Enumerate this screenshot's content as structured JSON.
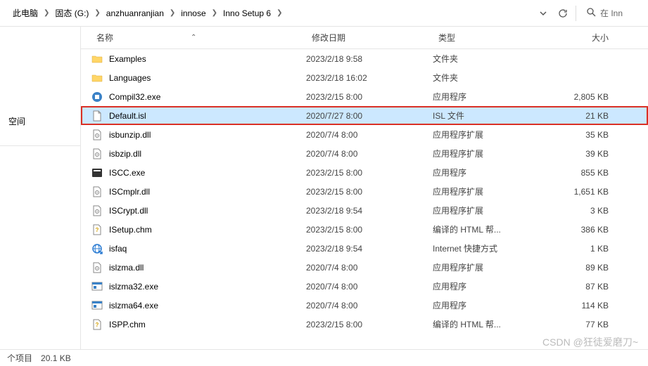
{
  "breadcrumb": [
    {
      "label": "此电脑"
    },
    {
      "label": "固态 (G:)"
    },
    {
      "label": "anzhuanranjian"
    },
    {
      "label": "innose"
    },
    {
      "label": "Inno Setup 6"
    }
  ],
  "search": {
    "placeholder": "在 Inn"
  },
  "nav": {
    "item1": "空间"
  },
  "columns": {
    "name": "名称",
    "date": "修改日期",
    "type": "类型",
    "size": "大小"
  },
  "files": [
    {
      "icon": "folder",
      "name": "Examples",
      "date": "2023/2/18 9:58",
      "type": "文件夹",
      "size": ""
    },
    {
      "icon": "folder",
      "name": "Languages",
      "date": "2023/2/18 16:02",
      "type": "文件夹",
      "size": ""
    },
    {
      "icon": "exe-blue",
      "name": "Compil32.exe",
      "date": "2023/2/15 8:00",
      "type": "应用程序",
      "size": "2,805 KB"
    },
    {
      "icon": "file",
      "name": "Default.isl",
      "date": "2020/7/27 8:00",
      "type": "ISL 文件",
      "size": "21 KB",
      "selected": true,
      "highlighted": true
    },
    {
      "icon": "dll",
      "name": "isbunzip.dll",
      "date": "2020/7/4 8:00",
      "type": "应用程序扩展",
      "size": "35 KB"
    },
    {
      "icon": "dll",
      "name": "isbzip.dll",
      "date": "2020/7/4 8:00",
      "type": "应用程序扩展",
      "size": "39 KB"
    },
    {
      "icon": "exe-dark",
      "name": "ISCC.exe",
      "date": "2023/2/15 8:00",
      "type": "应用程序",
      "size": "855 KB"
    },
    {
      "icon": "dll",
      "name": "ISCmplr.dll",
      "date": "2023/2/15 8:00",
      "type": "应用程序扩展",
      "size": "1,651 KB"
    },
    {
      "icon": "dll",
      "name": "ISCrypt.dll",
      "date": "2023/2/18 9:54",
      "type": "应用程序扩展",
      "size": "3 KB"
    },
    {
      "icon": "chm",
      "name": "ISetup.chm",
      "date": "2023/2/15 8:00",
      "type": "编译的 HTML 帮...",
      "size": "386 KB"
    },
    {
      "icon": "net",
      "name": "isfaq",
      "date": "2023/2/18 9:54",
      "type": "Internet 快捷方式",
      "size": "1 KB"
    },
    {
      "icon": "dll",
      "name": "islzma.dll",
      "date": "2020/7/4 8:00",
      "type": "应用程序扩展",
      "size": "89 KB"
    },
    {
      "icon": "exe-win",
      "name": "islzma32.exe",
      "date": "2020/7/4 8:00",
      "type": "应用程序",
      "size": "87 KB"
    },
    {
      "icon": "exe-win",
      "name": "islzma64.exe",
      "date": "2020/7/4 8:00",
      "type": "应用程序",
      "size": "114 KB"
    },
    {
      "icon": "chm",
      "name": "ISPP.chm",
      "date": "2023/2/15 8:00",
      "type": "编译的 HTML 帮...",
      "size": "77 KB"
    }
  ],
  "status": {
    "left": "个项目",
    "selected": "20.1 KB"
  },
  "watermark": "CSDN @狂徒爱磨刀~"
}
